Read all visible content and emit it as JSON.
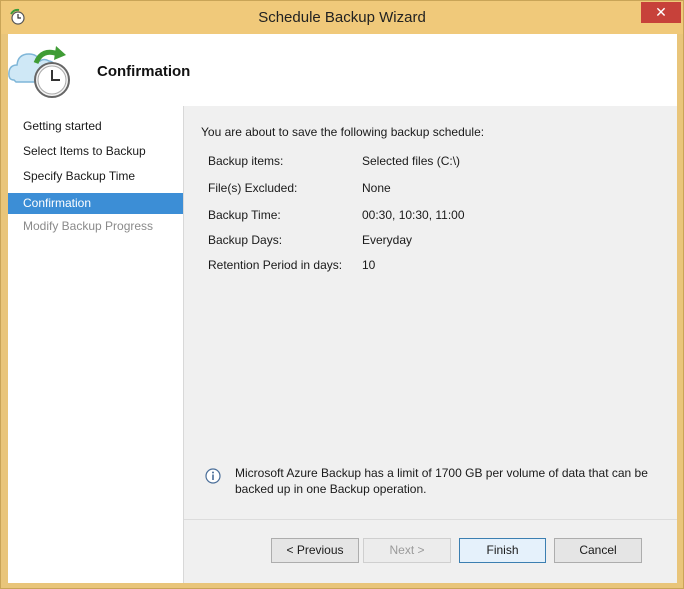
{
  "window": {
    "title": "Schedule Backup Wizard",
    "close_glyph": "✕"
  },
  "header": {
    "title": "Confirmation",
    "icon": "cloud-clock-icon"
  },
  "sidebar": {
    "steps": [
      {
        "label": "Getting started",
        "state": "normal"
      },
      {
        "label": "Select Items to Backup",
        "state": "normal"
      },
      {
        "label": "Specify Backup Time",
        "state": "normal"
      },
      {
        "label": "Confirmation",
        "state": "active"
      },
      {
        "label": "Modify Backup Progress",
        "state": "disabled"
      }
    ]
  },
  "main": {
    "intro": "You are about to save the following backup schedule:",
    "details": [
      {
        "label": "Backup items:",
        "value": "Selected files (C:\\)"
      },
      {
        "label": "File(s) Excluded:",
        "value": "None"
      },
      {
        "label": "Backup Time:",
        "value": "00:30, 10:30, 11:00"
      },
      {
        "label": "Backup Days:",
        "value": "Everyday"
      },
      {
        "label": "Retention Period in days:",
        "value": "10"
      }
    ],
    "note": "Microsoft Azure Backup has a limit of 1700 GB per volume of data that can be backed up in one Backup operation."
  },
  "buttons": {
    "previous": "< Previous",
    "next": "Next >",
    "finish": "Finish",
    "cancel": "Cancel"
  },
  "colors": {
    "title_bar": "#f0c97a",
    "active_step": "#3c8ed6",
    "close_button": "#c7413a"
  }
}
